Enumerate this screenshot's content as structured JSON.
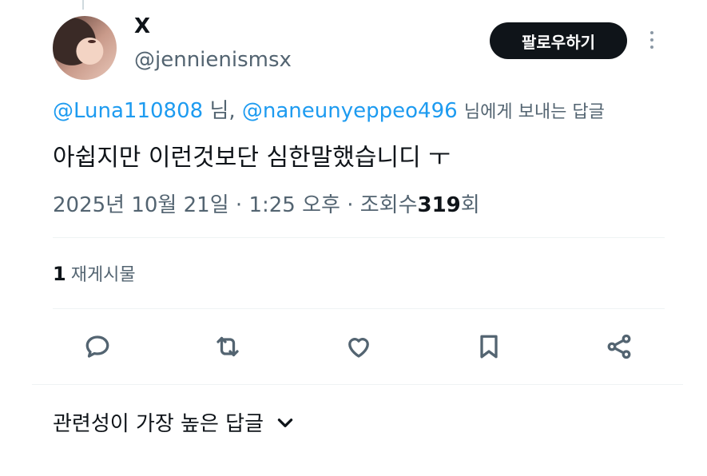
{
  "author": {
    "display_name": "X",
    "handle": "@jennienismsx"
  },
  "follow_button": {
    "label": "팔로우하기"
  },
  "reply_context": {
    "mention1": "@Luna110808",
    "sep": "님,",
    "mention2": "@naneunyeppeo496",
    "suffix": "님에게 보내는 답글"
  },
  "tweet": {
    "text": "아쉽지만 이런것보단 심한말했습니디 ㅜ"
  },
  "meta": {
    "date": "2025년 10월 21일",
    "dot1": "·",
    "time": "1:25 오후",
    "dot2": "·",
    "views_label": "조회수",
    "views_count": "319",
    "views_suffix": "회"
  },
  "reposts": {
    "count": "1",
    "label": "재게시물"
  },
  "actions": [
    {
      "icon": "reply-icon"
    },
    {
      "icon": "retweet-icon"
    },
    {
      "icon": "like-icon"
    },
    {
      "icon": "bookmark-icon"
    },
    {
      "icon": "share-icon"
    }
  ],
  "replies_sort": {
    "label": "관련성이 가장 높은 답글"
  }
}
